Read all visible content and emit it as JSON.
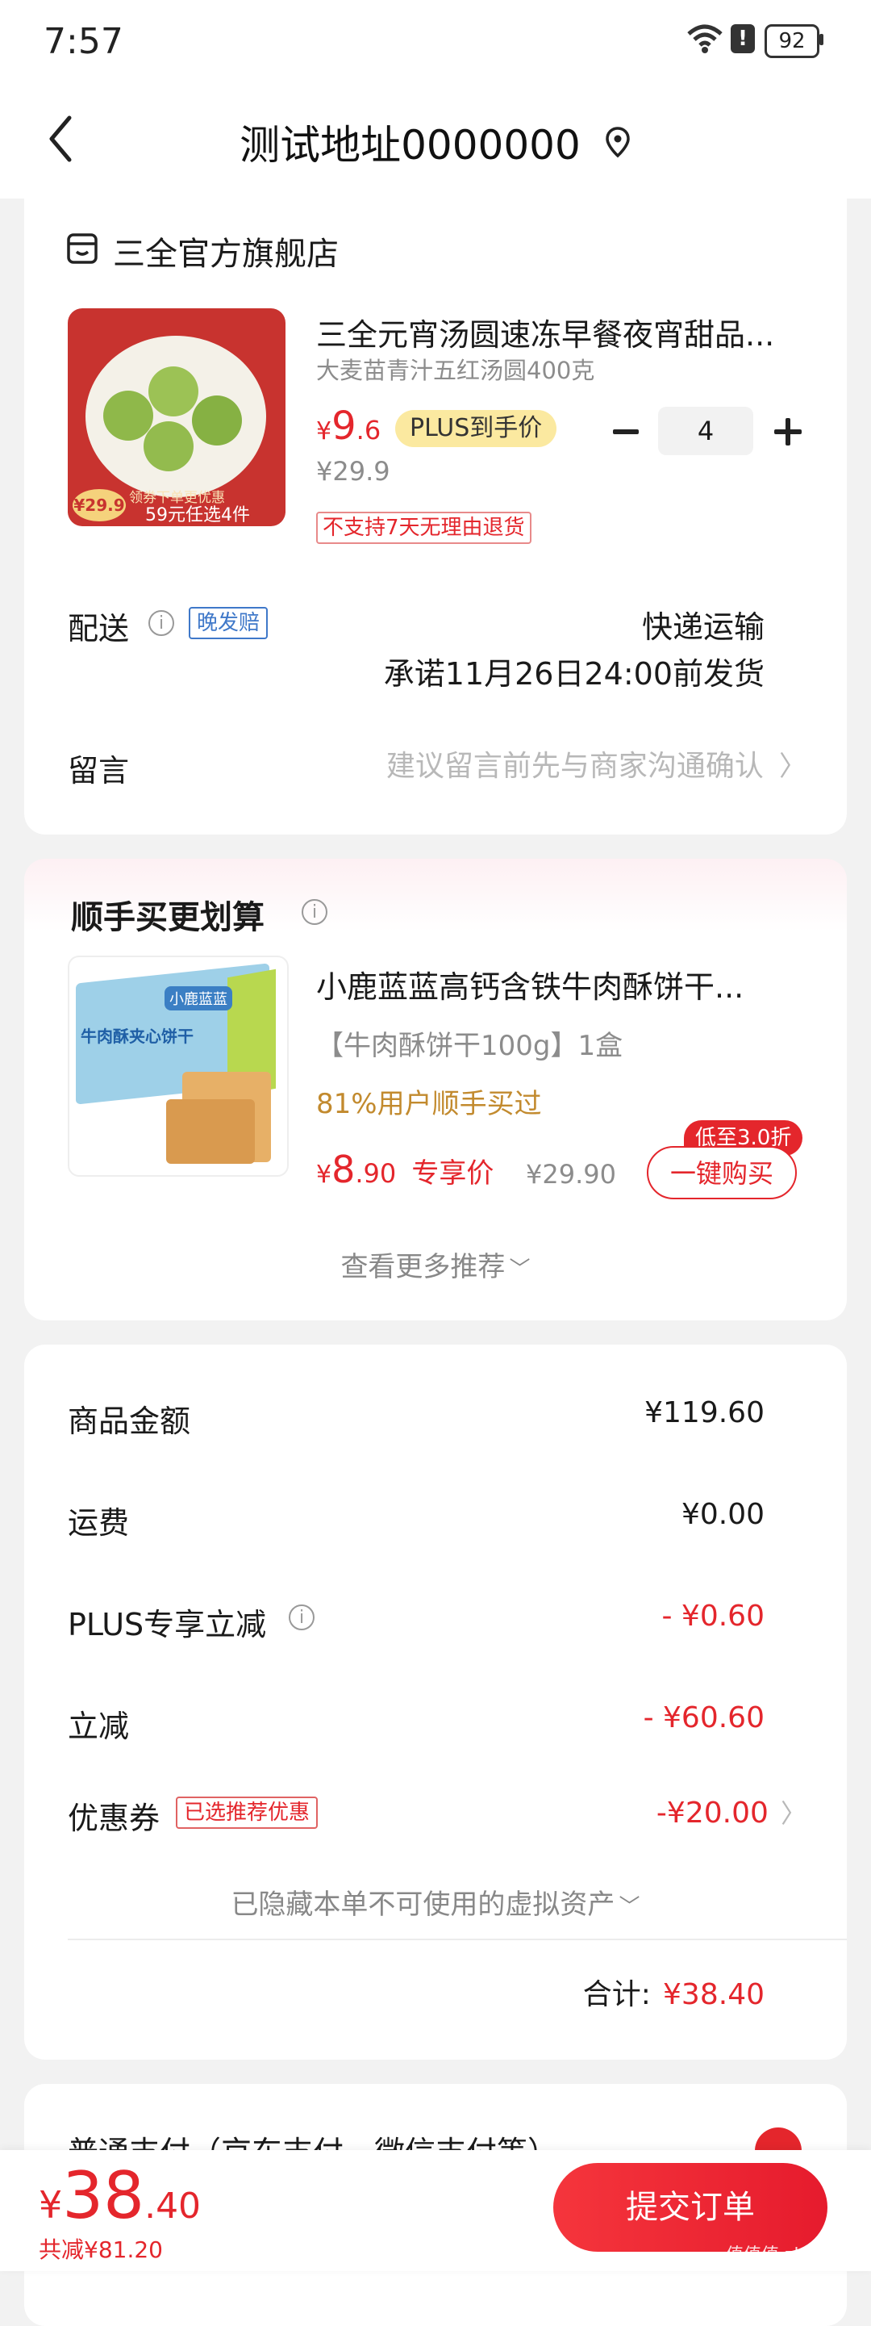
{
  "status_bar": {
    "time": "7:57",
    "battery": "92"
  },
  "header": {
    "address": "测试地址0000000"
  },
  "store": {
    "name": "三全官方旗舰店",
    "product": {
      "title": "三全元宵汤圆速冻早餐夜宵甜品...",
      "spec": "大麦苗青汁五红汤圆400克",
      "price_symbol": "¥",
      "price_int": "9",
      "price_dec": ".6",
      "price_tag": "PLUS到手价",
      "original_price": "¥29.9",
      "quantity": "4",
      "return_notice": "不支持7天无理由退货",
      "image_badge_price": "¥29.9",
      "image_badge_top": "领券下单更优惠",
      "image_badge_text": "59元任选4件"
    },
    "delivery": {
      "label": "配送",
      "tag": "晚发赔",
      "method": "快递运输",
      "promise": "承诺11月26日24:00前发货"
    },
    "message": {
      "label": "留言",
      "placeholder": "建议留言前先与商家沟通确认"
    }
  },
  "recommend": {
    "title": "顺手买更划算",
    "product": {
      "title": "小鹿蓝蓝高钙含铁牛肉酥饼干...",
      "spec": "【牛肉酥饼干100g】1盒",
      "social": "81%用户顺手买过",
      "price_symbol": "¥",
      "price_int": "8",
      "price_dec": ".90",
      "price_tag": "专享价",
      "original_price": "¥29.90",
      "discount_badge": "低至3.0折",
      "buy_button": "一键购买",
      "image_brand": "小鹿蓝蓝",
      "image_text": "牛肉酥夹心饼干"
    },
    "more": "查看更多推荐"
  },
  "summary": {
    "rows": [
      {
        "label": "商品金额",
        "value": "¥119.60"
      },
      {
        "label": "运费",
        "value": "¥0.00"
      },
      {
        "label": "PLUS专享立减",
        "value": "- ¥0.60"
      },
      {
        "label": "立减",
        "value": "- ¥60.60"
      },
      {
        "label": "优惠券",
        "tag": "已选推荐优惠",
        "value": "-¥20.00"
      }
    ],
    "hidden_assets": "已隐藏本单不可使用的虚拟资产",
    "total_label": "合计:",
    "total_value": "¥38.40"
  },
  "payment": {
    "label": "普通支付（京东支付、微信支付等）"
  },
  "bottom_bar": {
    "price_symbol": "¥",
    "price_int": "38",
    "price_dec": ".40",
    "saved": "共减¥81.20",
    "submit": "提交订单"
  },
  "watermark": "值值值 zhizhizhi.com"
}
